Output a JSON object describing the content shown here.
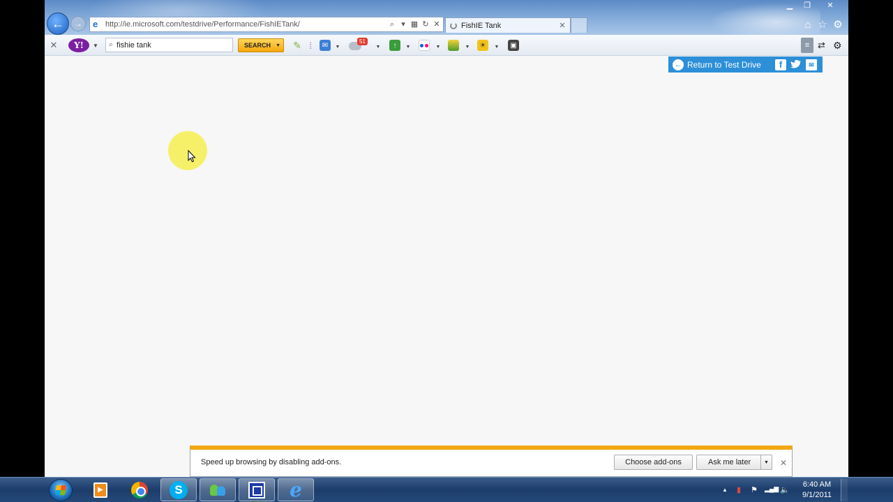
{
  "browser": {
    "address_url": "http://ie.microsoft.com/testdrive/Performance/FishIETank/",
    "tab_title": "FishIE Tank"
  },
  "toolbar": {
    "search_value": "fishie tank",
    "search_button_label": "SEARCH",
    "mail_badge_count": "51"
  },
  "page": {
    "return_label": "Return to Test Drive"
  },
  "notification": {
    "message": "Speed up browsing by disabling add-ons.",
    "choose_label": "Choose add-ons",
    "ask_label": "Ask me later"
  },
  "taskbar": {
    "time": "6:40 AM",
    "date": "9/1/2011"
  },
  "colors": {
    "testdrive_blue": "#2d8fd8",
    "notification_accent": "#f3a614",
    "cursor_highlight": "#f6ee50"
  },
  "icons": [
    "back-arrow-icon",
    "forward-arrow-icon",
    "ie-icon",
    "search-icon",
    "refresh-icon",
    "home-icon",
    "star-icon",
    "gear-icon",
    "yahoo-icon",
    "mail-icon",
    "facebook-icon",
    "twitter-icon",
    "email-icon",
    "chrome-icon",
    "skype-icon",
    "volume-icon"
  ]
}
